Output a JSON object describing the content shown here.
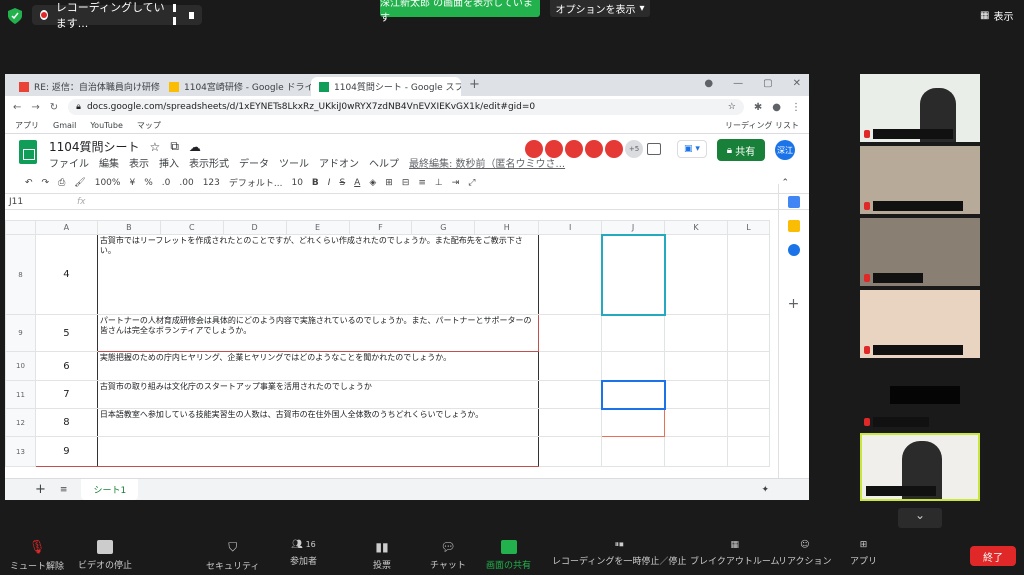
{
  "top": {
    "recording_text": "レコーディングしています...",
    "sharing_banner": "深江新太郎 の画面を表示しています",
    "options_label": "オプションを表示",
    "view_label": "表示"
  },
  "browser": {
    "tabs": [
      {
        "title": "RE: 返信：自治体職員向け研修に"
      },
      {
        "title": "1104宮崎研修 - Google ドライブ"
      },
      {
        "title": "1104質問シート - Google スプレット"
      }
    ],
    "url": "docs.google.com/spreadsheets/d/1xEYNETs8LkxRz_UKkiJ0wRYX7zdNB4VnEVXIEKvGX1k/edit#gid=0",
    "bookmarks": [
      "アプリ",
      "Gmail",
      "YouTube",
      "マップ",
      "リーディング リスト"
    ]
  },
  "sheet": {
    "title": "1104質問シート",
    "menus": [
      "ファイル",
      "編集",
      "表示",
      "挿入",
      "表示形式",
      "データ",
      "ツール",
      "アドオン",
      "ヘルプ",
      "最終編集: 数秒前（匿名ウミウさ..."
    ],
    "avatar_count": "+5",
    "share_label": "共有",
    "user_initials": "深江",
    "toolbar": {
      "zoom": "100%",
      "currency": "¥",
      "percent": "%",
      "dec1": ".0",
      "dec2": ".00",
      "format": "123",
      "font": "デフォルト...",
      "size": "10"
    },
    "cell_ref": "J11",
    "columns": [
      "A",
      "B",
      "C",
      "D",
      "E",
      "F",
      "G",
      "H",
      "I",
      "J",
      "K",
      "L"
    ],
    "rows": [
      {
        "rn": "8",
        "num": "4",
        "text": "古賀市ではリーフレットを作成されたとのことですが、どれくらい作成されたのでしょうか。また配布先をご教示下さい。"
      },
      {
        "rn": "9",
        "num": "5",
        "text": "パートナーの人材育成研修会は具体的にどのよう内容で実施されているのでしょうか。また、パートナーとサポーターの皆さんは完全なボランティアでしょうか。"
      },
      {
        "rn": "10",
        "num": "6",
        "text": "実態把握のための庁内ヒヤリング、企業ヒヤリングではどのようなことを聞かれたのでしょうか。"
      },
      {
        "rn": "11",
        "num": "7",
        "text": "古賀市の取り組みは文化庁のスタートアップ事業を活用されたのでしょうか"
      },
      {
        "rn": "12",
        "num": "8",
        "text": "日本語教室へ参加している技能実習生の人数は、古賀市の在住外国人全体数のうちどれくらいでしょうか。"
      },
      {
        "rn": "13",
        "num": "9",
        "text": ""
      }
    ],
    "sheet_tab": "シート1"
  },
  "bottom": {
    "mute": "ミュート解除",
    "video": "ビデオの停止",
    "security": "セキュリティ",
    "participants": "参加者",
    "participants_count": "16",
    "polls": "投票",
    "chat": "チャット",
    "share": "画面の共有",
    "pause_rec": "レコーディングを一時停止／停止",
    "breakout": "ブレイクアウトルーム",
    "reactions": "リアクション",
    "apps": "アプリ",
    "end": "終了"
  }
}
